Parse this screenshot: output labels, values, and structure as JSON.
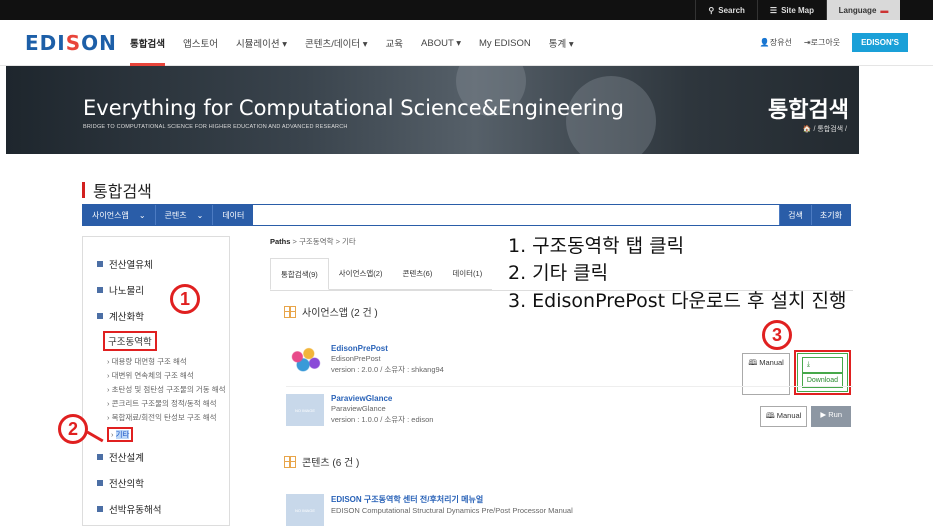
{
  "topbar": {
    "search": "Search",
    "sitemap": "Site Map",
    "language": "Language"
  },
  "nav": {
    "logo_a": "EDI",
    "logo_s": "S",
    "logo_b": "ON",
    "items": [
      "통합검색",
      "앱스토어",
      "시뮬레이션 ▾",
      "콘텐츠/데이터 ▾",
      "교육",
      "ABOUT ▾",
      "My EDISON",
      "통계 ▾"
    ],
    "user": "장유선",
    "logout": "로그아웃",
    "edisons": "EDISON'S"
  },
  "banner": {
    "headline": "Everything for Computational Science&Engineering",
    "subline": "BRIDGE TO COMPUTATIONAL SCIENCE FOR HIGHER EDUCATION AND ADVANCED RESEARCH",
    "title": "통합검색",
    "crumb": "🏠 / 통합검색 /"
  },
  "page_title": "통합검색",
  "filter": {
    "t1": "사이언스앱",
    "t2": "콘텐츠",
    "t3": "데이터",
    "search": "검색",
    "reset": "초기화"
  },
  "sidebar": {
    "c1": "전산열유체",
    "c2": "나노물리",
    "c3": "계산화학",
    "c4": "구조동역학",
    "subs": [
      "› 대용량 대면형 구조 해석",
      "› 대변위 연속체의 구조 해석",
      "› 초탄성 및 점탄성 구조물의 거동 해석",
      "› 콘크리트 구조물의 정적/동적 해석",
      "› 복합재료/회전익 탄성보 구조 해석"
    ],
    "etc": "기타",
    "c5": "전산설계",
    "c6": "전산의학",
    "c7": "선박유동해석"
  },
  "main": {
    "paths_label": "Paths",
    "paths": " >  구조동역학  >  기타",
    "tabs": [
      "통합검색(9)",
      "사이언스앱(2)",
      "콘텐츠(6)",
      "데이터(1)"
    ],
    "sec1": "사이언스앱 (2 건 )",
    "sec2": "콘텐츠 (6 건 )",
    "noimage": "NO IMAGE",
    "app1": {
      "name": "EdisonPrePost",
      "sub": "EdisonPrePost",
      "meta": "version : 2.0.0 / 소유자 : shkang94"
    },
    "app2": {
      "name": "ParaviewGlance",
      "sub": "ParaviewGlance",
      "meta": "version : 1.0.0 / 소유자 : edison"
    },
    "manual": "Manual",
    "download": "Download",
    "run": "Run",
    "content1": {
      "name": "EDISON 구조동역학 센터 전/후처리기 메뉴얼",
      "sub": "EDISON Computational Structural Dynamics Pre/Post Processor Manual"
    }
  },
  "notes": [
    "1. 구조동역학 탭 클릭",
    "2. 기타 클릭",
    "3. EdisonPrePost 다운로드 후 설치 진행"
  ],
  "markers": [
    "1",
    "2",
    "3"
  ]
}
